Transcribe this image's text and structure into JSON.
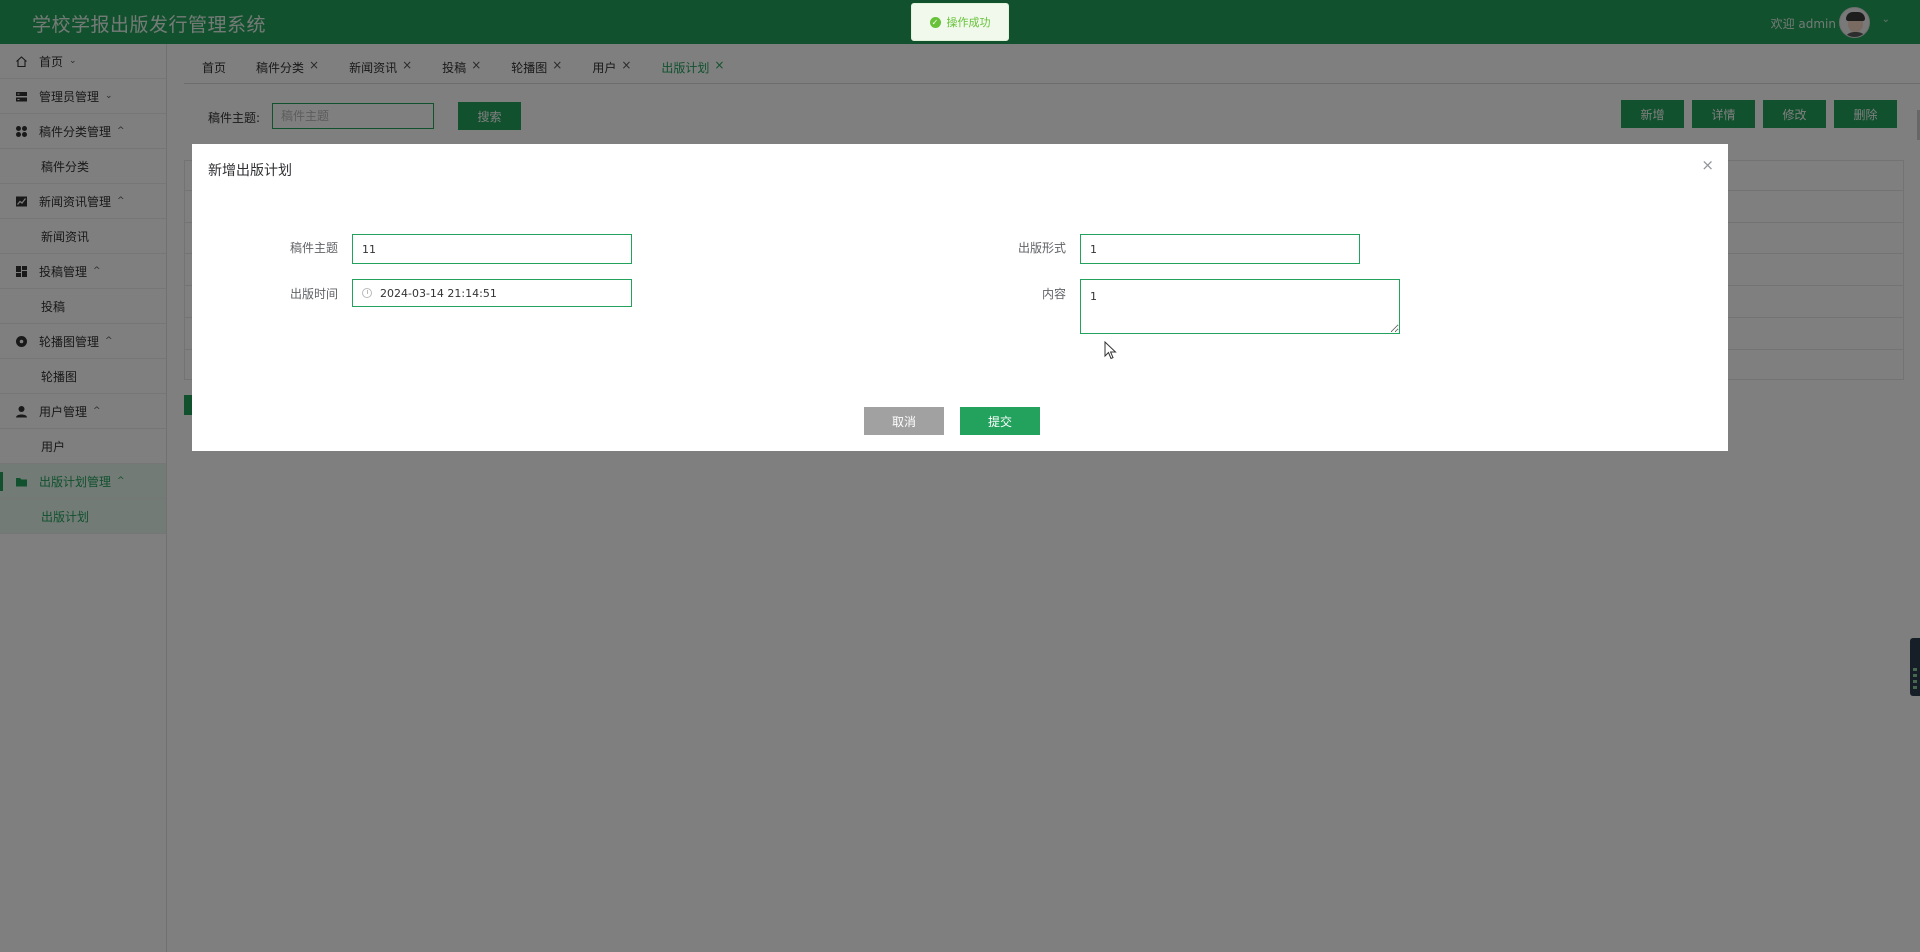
{
  "header": {
    "app_title": "学校学报出版发行管理系统",
    "welcome": "欢迎 admin"
  },
  "toast": {
    "message": "操作成功"
  },
  "sidebar": {
    "items": [
      {
        "label": "首页",
        "icon": "home-icon",
        "chevron": "⌄"
      },
      {
        "label": "管理员管理",
        "icon": "server-icon",
        "chevron": "⌄"
      },
      {
        "label": "稿件分类管理",
        "icon": "grid-icon",
        "chevron": "^",
        "sub": "稿件分类"
      },
      {
        "label": "新闻资讯管理",
        "icon": "chart-icon",
        "chevron": "^",
        "sub": "新闻资讯"
      },
      {
        "label": "投稿管理",
        "icon": "dashboard-icon",
        "chevron": "^",
        "sub": "投稿"
      },
      {
        "label": "轮播图管理",
        "icon": "disc-icon",
        "chevron": "^",
        "sub": "轮播图"
      },
      {
        "label": "用户管理",
        "icon": "user-icon",
        "chevron": "^",
        "sub": "用户"
      },
      {
        "label": "出版计划管理",
        "icon": "folder-icon",
        "chevron": "^",
        "sub": "出版计划"
      }
    ]
  },
  "tabs": [
    {
      "label": "首页",
      "closable": false
    },
    {
      "label": "稿件分类",
      "closable": true
    },
    {
      "label": "新闻资讯",
      "closable": true
    },
    {
      "label": "投稿",
      "closable": true
    },
    {
      "label": "轮播图",
      "closable": true
    },
    {
      "label": "用户",
      "closable": true
    },
    {
      "label": "出版计划",
      "closable": true,
      "active": true
    }
  ],
  "search": {
    "label": "稿件主题:",
    "placeholder": "稿件主题",
    "button": "搜索"
  },
  "actions": {
    "add": "新增",
    "detail": "详情",
    "edit": "修改",
    "delete": "删除"
  },
  "modal": {
    "title": "新增出版计划",
    "close": "×",
    "fields": {
      "subject_label": "稿件主题",
      "subject_value": "11",
      "form_label": "出版形式",
      "form_value": "1",
      "time_label": "出版时间",
      "time_value": "2024-03-14 21:14:51",
      "content_label": "内容",
      "content_value": "1"
    },
    "cancel": "取消",
    "submit": "提交"
  },
  "colors": {
    "primary": "#23a25d",
    "overlay": "rgba(0,0,0,0.5)",
    "toast_bg": "#f0f9eb",
    "toast_text": "#67c23a",
    "cancel_btn": "#a1a1a1"
  }
}
